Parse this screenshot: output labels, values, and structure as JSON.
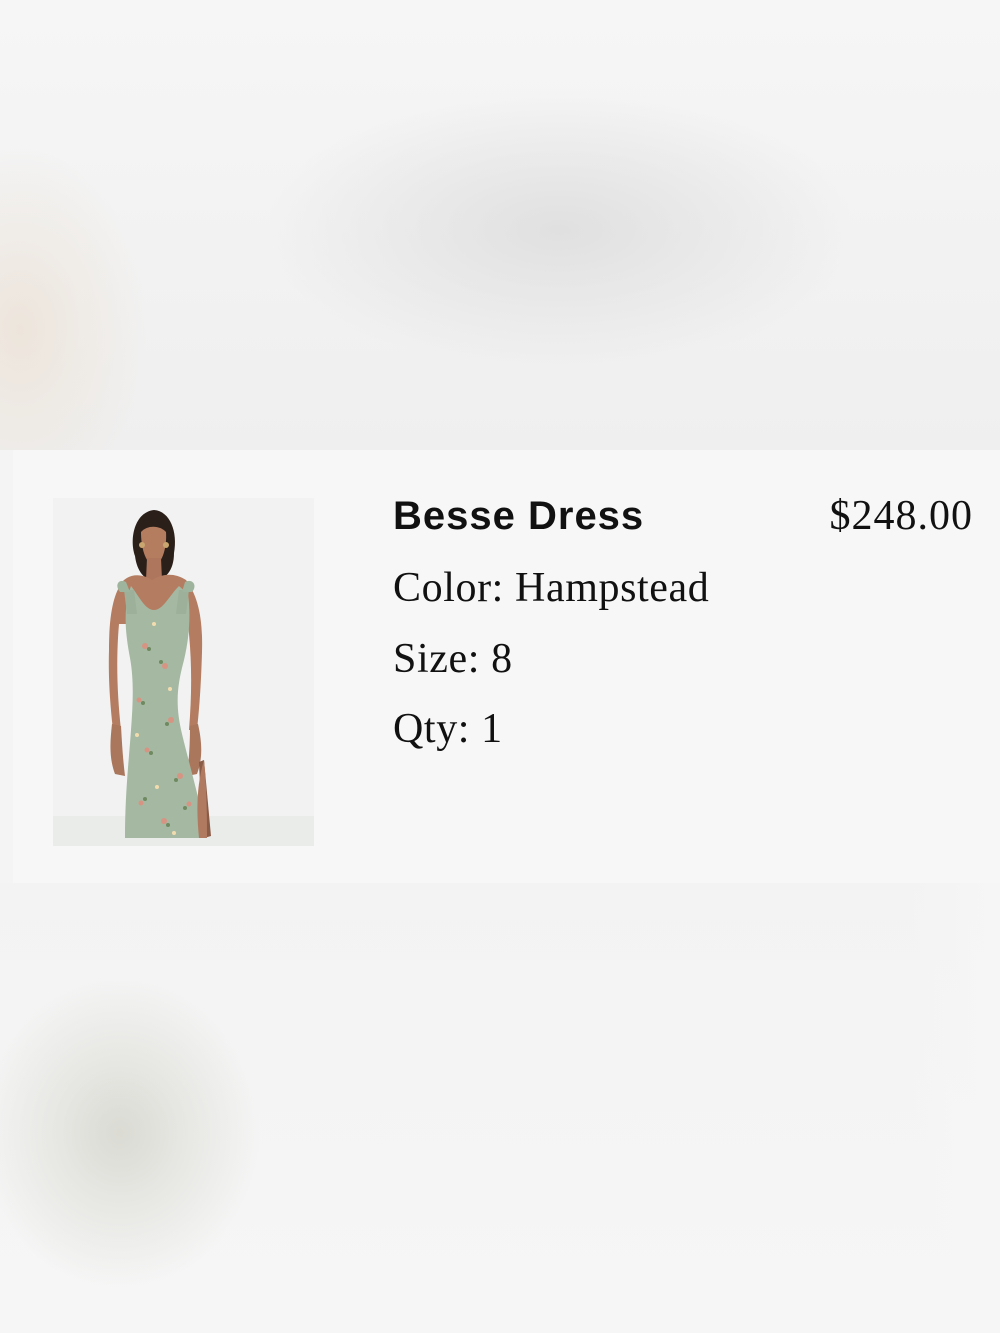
{
  "cart_item": {
    "name": "Besse Dress",
    "price": "$248.00",
    "color_line": "Color: Hampstead",
    "size_line": "Size: 8",
    "qty_line": "Qty: 1"
  },
  "colors": {
    "background": "#f4f4f4",
    "card": "#f7f7f7",
    "text": "#111111",
    "dress": "#a4b8a2",
    "skin": "#b17a5f"
  }
}
